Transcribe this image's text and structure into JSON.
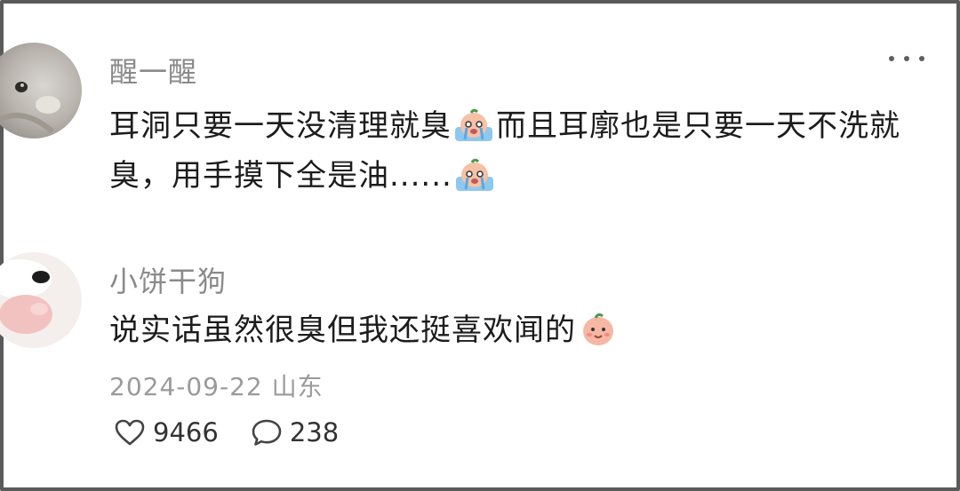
{
  "comments": [
    {
      "username": "醒一醒",
      "text_part1": "耳洞只要一天没清理就臭",
      "emoji1": "crying-peach-emoji",
      "text_part2": "而且耳廓也是只要一天不洗就臭，用手摸下全是油......",
      "emoji2": "crying-peach-emoji",
      "more_icon": "more-dots-icon"
    },
    {
      "username": "小饼干狗",
      "text": "说实话虽然很臭但我还挺喜欢闻的",
      "emoji": "smiling-peach-emoji",
      "date": "2024-09-22",
      "location": "山东",
      "likes": "9466",
      "replies": "238",
      "like_icon": "heart-icon",
      "reply_icon": "comment-bubble-icon"
    }
  ],
  "colors": {
    "username": "#8a8a8a",
    "text": "#1c1c1c",
    "meta": "#9a9a9a",
    "border": "#5a5a5a"
  }
}
